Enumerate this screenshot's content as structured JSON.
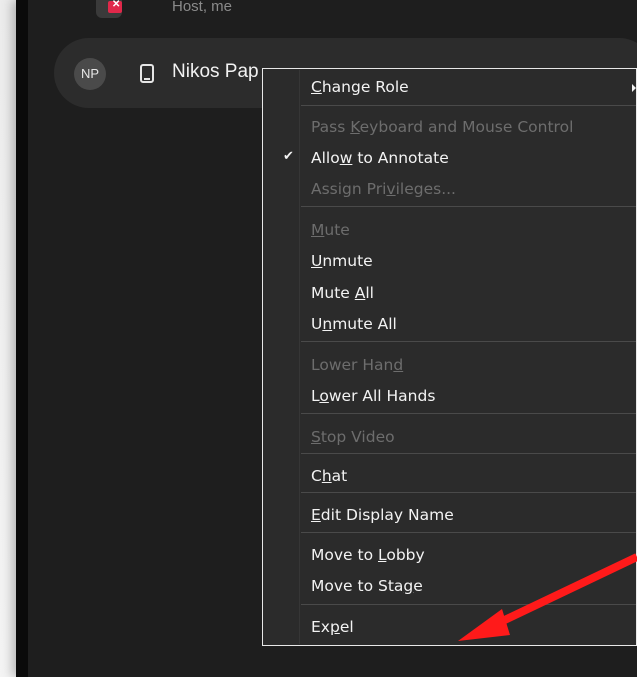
{
  "previous_participant": {
    "subtitle": "Host, me"
  },
  "participant": {
    "initials": "NP",
    "name": "Nikos Pap"
  },
  "context_menu": {
    "items": [
      {
        "label": "Change Role",
        "mnemonic": "C",
        "enabled": true,
        "checked": false,
        "submenu": true
      },
      {
        "label": "Pass Keyboard and Mouse Control",
        "mnemonic": "K",
        "enabled": false,
        "checked": false,
        "submenu": false
      },
      {
        "label": "Allow to Annotate",
        "mnemonic": "w",
        "enabled": true,
        "checked": true,
        "submenu": false
      },
      {
        "label": "Assign Privileges...",
        "mnemonic": "v",
        "enabled": false,
        "checked": false,
        "submenu": false
      },
      {
        "label": "Mute",
        "mnemonic": "M",
        "enabled": false,
        "checked": false,
        "submenu": false
      },
      {
        "label": "Unmute",
        "mnemonic": "U",
        "enabled": true,
        "checked": false,
        "submenu": false
      },
      {
        "label": "Mute All",
        "mnemonic": "A",
        "enabled": true,
        "checked": false,
        "submenu": false
      },
      {
        "label": "Unmute All",
        "mnemonic": "n",
        "enabled": true,
        "checked": false,
        "submenu": false
      },
      {
        "label": "Lower Hand",
        "mnemonic": "d",
        "enabled": false,
        "checked": false,
        "submenu": false
      },
      {
        "label": "Lower All Hands",
        "mnemonic": "o",
        "enabled": true,
        "checked": false,
        "submenu": false
      },
      {
        "label": "Stop Video",
        "mnemonic": "S",
        "enabled": false,
        "checked": false,
        "submenu": false
      },
      {
        "label": "Chat",
        "mnemonic": "h",
        "enabled": true,
        "checked": false,
        "submenu": false
      },
      {
        "label": "Edit Display Name",
        "mnemonic": "E",
        "enabled": true,
        "checked": false,
        "submenu": false
      },
      {
        "label": "Move to Lobby",
        "mnemonic": "L",
        "enabled": true,
        "checked": false,
        "submenu": false
      },
      {
        "label": "Move to Stage",
        "mnemonic": "g",
        "enabled": true,
        "checked": false,
        "submenu": false
      },
      {
        "label": "Expel",
        "mnemonic": "p",
        "enabled": true,
        "checked": false,
        "submenu": false
      }
    ]
  },
  "annotation": {
    "arrow_color": "#ff1a1a",
    "points_to": "Expel"
  },
  "colors": {
    "background": "#1e1e1e",
    "menu_bg": "#2b2b2b",
    "menu_border": "#e8e8e8",
    "text": "#f3f3f3",
    "disabled_text": "#6d6d6d"
  }
}
